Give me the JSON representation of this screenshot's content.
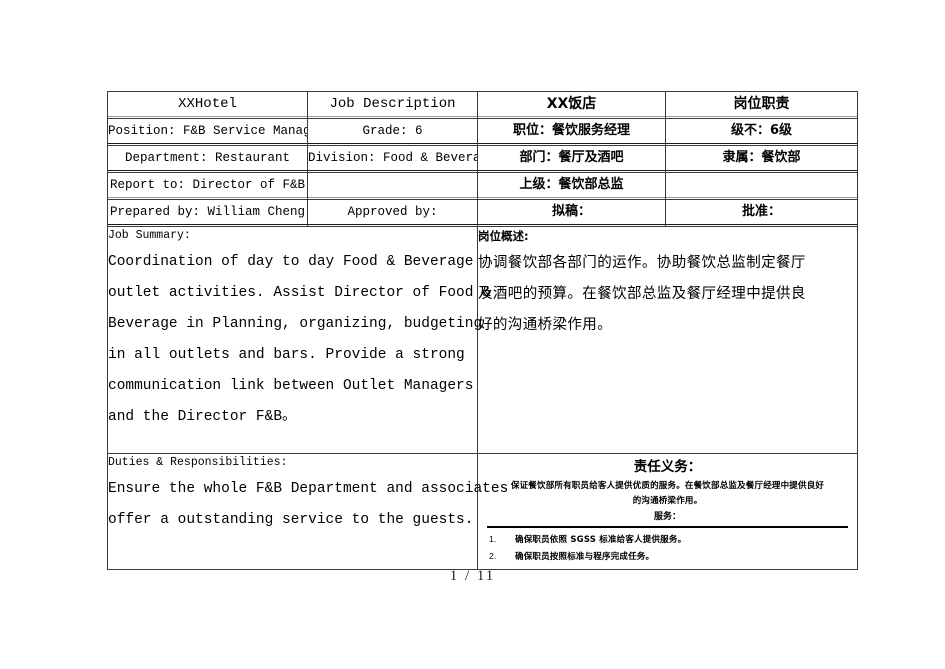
{
  "document": {
    "footer_page": "1  /  11"
  },
  "header_table": {
    "row1": {
      "company_en": "XXHotel",
      "doc_title_en": "Job Description",
      "company_cn": "XX饭店",
      "doc_title_cn": "岗位职责"
    },
    "row2": {
      "position_en": "Position: F&B Service Manager",
      "grade_en": "Grade:        6",
      "position_cn": "职位：餐饮服务经理",
      "grade_cn": "级不：6级"
    },
    "row3": {
      "department_en": "Department: Restaurant",
      "division_en": "Division: Food & Beverage",
      "department_cn": "部门：餐厅及酒吧",
      "division_cn": "隶属：餐饮部"
    },
    "row4": {
      "report_to_en": "Report to: Director of F&B",
      "blank_mid": "",
      "report_to_cn": "上级：餐饮部总监",
      "blank_right": ""
    },
    "row5": {
      "prepared_by_en": "Prepared by: William Cheng",
      "approved_by_en": "Approved by:",
      "prepared_by_cn": "拟稿：",
      "approved_by_cn": "批准："
    }
  },
  "summary": {
    "label_en": "Job Summary:",
    "lines_en": [
      "Coordination of day to day Food & Beverage",
      "outlet activities. Assist Director of Food &",
      "Beverage in Planning, organizing, budgeting",
      "in all outlets and bars. Provide a strong",
      "communication link between Outlet Managers",
      "and the Director F&B。"
    ],
    "label_cn": "岗位概述:",
    "lines_cn": [
      "协调餐饮部各部门的运作。协助餐饮总监制定餐厅",
      "及酒吧的预算。在餐饮部总监及餐厅经理中提供良",
      "好的沟通桥梁作用。"
    ]
  },
  "duties": {
    "label_en": "Duties & Responsibilities:",
    "lines_en": [
      "Ensure the whole F&B Department and associates",
      "offer a outstanding service to the guests."
    ],
    "heading_cn": "责任义务：",
    "body_cn": [
      "保证餐饮部所有职员给客人提供优质的服务。在餐饮部总监及餐厅经理中提供良好",
      "的沟通桥梁作用。"
    ],
    "section_cn": "服务：",
    "list_cn": [
      {
        "num": "1.",
        "text": "确保职员依照 SGSS 标准给客人提供服务。"
      },
      {
        "num": "2.",
        "text": "确保职员按照标准与程序完成任务。"
      }
    ]
  }
}
